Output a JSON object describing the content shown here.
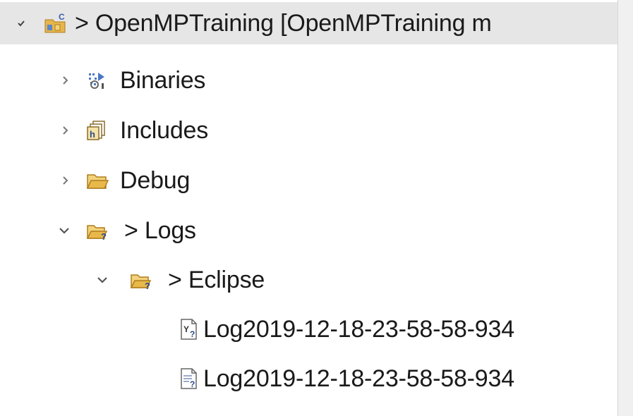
{
  "project_explorer": {
    "items": [
      {
        "decoration": ">",
        "label": "OpenMPTraining [OpenMPTraining m",
        "icon": "c-project-icon",
        "state": "expanded",
        "selected": true
      },
      {
        "decoration": "",
        "label": "Binaries",
        "icon": "binaries-icon",
        "state": "collapsed"
      },
      {
        "decoration": "",
        "label": "Includes",
        "icon": "includes-icon",
        "state": "collapsed"
      },
      {
        "decoration": "",
        "label": "Debug",
        "icon": "folder-icon",
        "state": "collapsed"
      },
      {
        "decoration": ">",
        "label": "Logs",
        "icon": "untracked-folder-icon",
        "state": "expanded"
      },
      {
        "decoration": ">",
        "label": "Eclipse",
        "icon": "untracked-folder-icon",
        "state": "expanded"
      },
      {
        "decoration": "",
        "label": "Log2019-12-18-23-58-58-934",
        "icon": "yaml-file-icon",
        "state": "leaf"
      },
      {
        "decoration": "",
        "label": "Log2019-12-18-23-58-58-934",
        "icon": "untracked-file-icon",
        "state": "leaf"
      }
    ]
  },
  "colors": {
    "selection": "#e6e6e6",
    "folder": "#e8b84a",
    "twisty": "#555555"
  }
}
